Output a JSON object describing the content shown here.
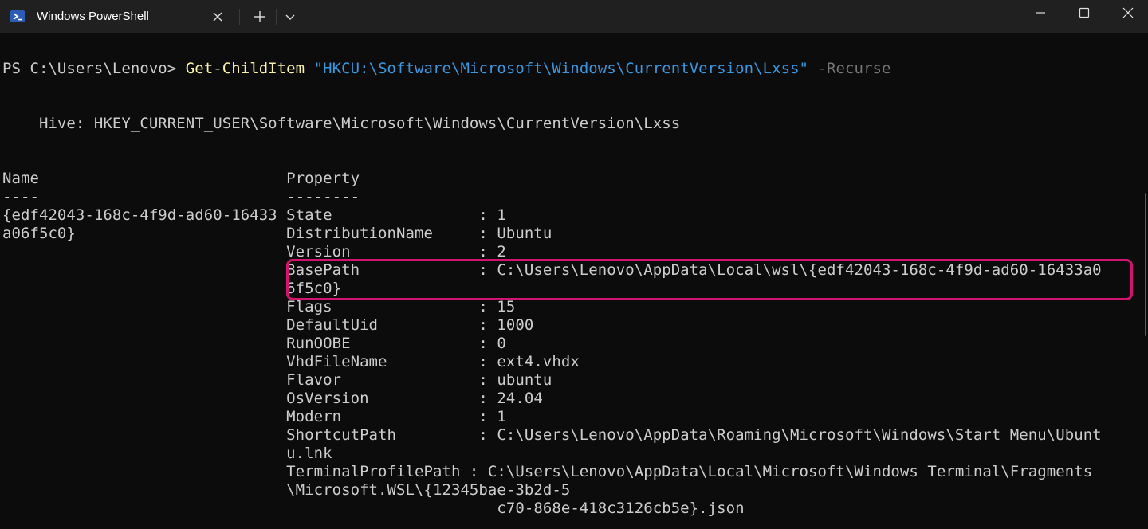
{
  "titlebar": {
    "tab_title": "Windows PowerShell",
    "new_tab_symbol": "+",
    "icons": {
      "app": "powershell-icon",
      "close": "close-icon",
      "dropdown": "chevron-down-icon",
      "minimize": "minimize-icon",
      "maximize": "maximize-icon",
      "window_close": "window-close-icon"
    }
  },
  "terminal": {
    "prompt": "PS C:\\Users\\Lenovo> ",
    "command": "Get-ChildItem",
    "argument": "\"HKCU:\\Software\\Microsoft\\Windows\\CurrentVersion\\Lxss\"",
    "parameter": "-Recurse",
    "hive_line": "    Hive: HKEY_CURRENT_USER\\Software\\Microsoft\\Windows\\CurrentVersion\\Lxss",
    "header_line": "Name                           Property",
    "underline_line": "----                           --------",
    "output_lines": [
      "{edf42043-168c-4f9d-ad60-16433 State                : 1",
      "a06f5c0}                       DistributionName     : Ubuntu",
      "                               Version              : 2",
      "                               BasePath             : C:\\Users\\Lenovo\\AppData\\Local\\wsl\\{edf42043-168c-4f9d-ad60-16433a0",
      "                               6f5c0}",
      "                               Flags                : 15",
      "                               DefaultUid           : 1000",
      "                               RunOOBE              : 0",
      "                               VhdFileName          : ext4.vhdx",
      "                               Flavor               : ubuntu",
      "                               OsVersion            : 24.04",
      "                               Modern               : 1",
      "                               ShortcutPath         : C:\\Users\\Lenovo\\AppData\\Roaming\\Microsoft\\Windows\\Start Menu\\Ubunt",
      "                               u.lnk",
      "                               TerminalProfilePath : C:\\Users\\Lenovo\\AppData\\Local\\Microsoft\\Windows Terminal\\Fragments",
      "                               \\Microsoft.WSL\\{12345bae-3b2d-5",
      "                                                      c70-868e-418c3126cb5e}.json"
    ]
  },
  "colors": {
    "background": "#0c0c0c",
    "titlebar": "#202020",
    "text": "#cccccc",
    "command": "#f9f1a5",
    "string": "#3a96dd",
    "parameter": "#767676",
    "highlight_box": "#d3136f"
  }
}
